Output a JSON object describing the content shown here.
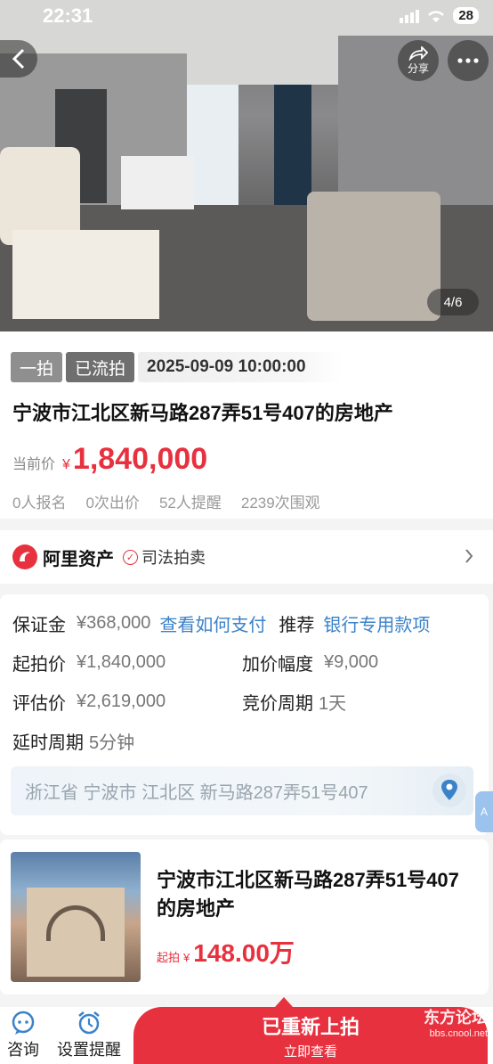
{
  "status_bar": {
    "time": "22:31",
    "battery": "28"
  },
  "header": {
    "share_label": "分享"
  },
  "gallery": {
    "counter": "4/6"
  },
  "auction": {
    "round_tag": "一拍",
    "state_tag": "已流拍",
    "datetime": "2025-09-09 10:00:00",
    "title": "宁波市江北区新马路287弄51号407的房地产",
    "price_label": "当前价",
    "currency": "¥",
    "price": "1,840,000",
    "stats": [
      "0人报名",
      "0次出价",
      "52人提醒",
      "2239次围观"
    ]
  },
  "provider": {
    "name": "阿里资产",
    "type": "司法拍卖"
  },
  "details": {
    "deposit_label": "保证金",
    "deposit_value": "¥368,000",
    "deposit_link": "查看如何支付",
    "recommend_label": "推荐",
    "recommend_link": "银行专用款项",
    "start_label": "起拍价",
    "start_value": "¥1,840,000",
    "increment_label": "加价幅度",
    "increment_value": "¥9,000",
    "appraisal_label": "评估价",
    "appraisal_value": "¥2,619,000",
    "cycle_label": "竞价周期",
    "cycle_value": "1天",
    "extend_label": "延时周期",
    "extend_value": "5分钟",
    "address": "浙江省 宁波市 江北区 新马路287弄51号407"
  },
  "related": {
    "title": "宁波市江北区新马路287弄51号407的房地产",
    "price_label": "起拍",
    "currency": "¥",
    "price": "148.00万"
  },
  "bottom_bar": {
    "consult_label": "咨询",
    "reminder_label": "设置提醒",
    "cta_main": "已重新上拍",
    "cta_sub": "立即查看"
  },
  "watermark": {
    "line1": "东方论坛",
    "line2": "bbs.cnool.net"
  },
  "colors": {
    "accent": "#e8313f",
    "link": "#3b82c9"
  }
}
